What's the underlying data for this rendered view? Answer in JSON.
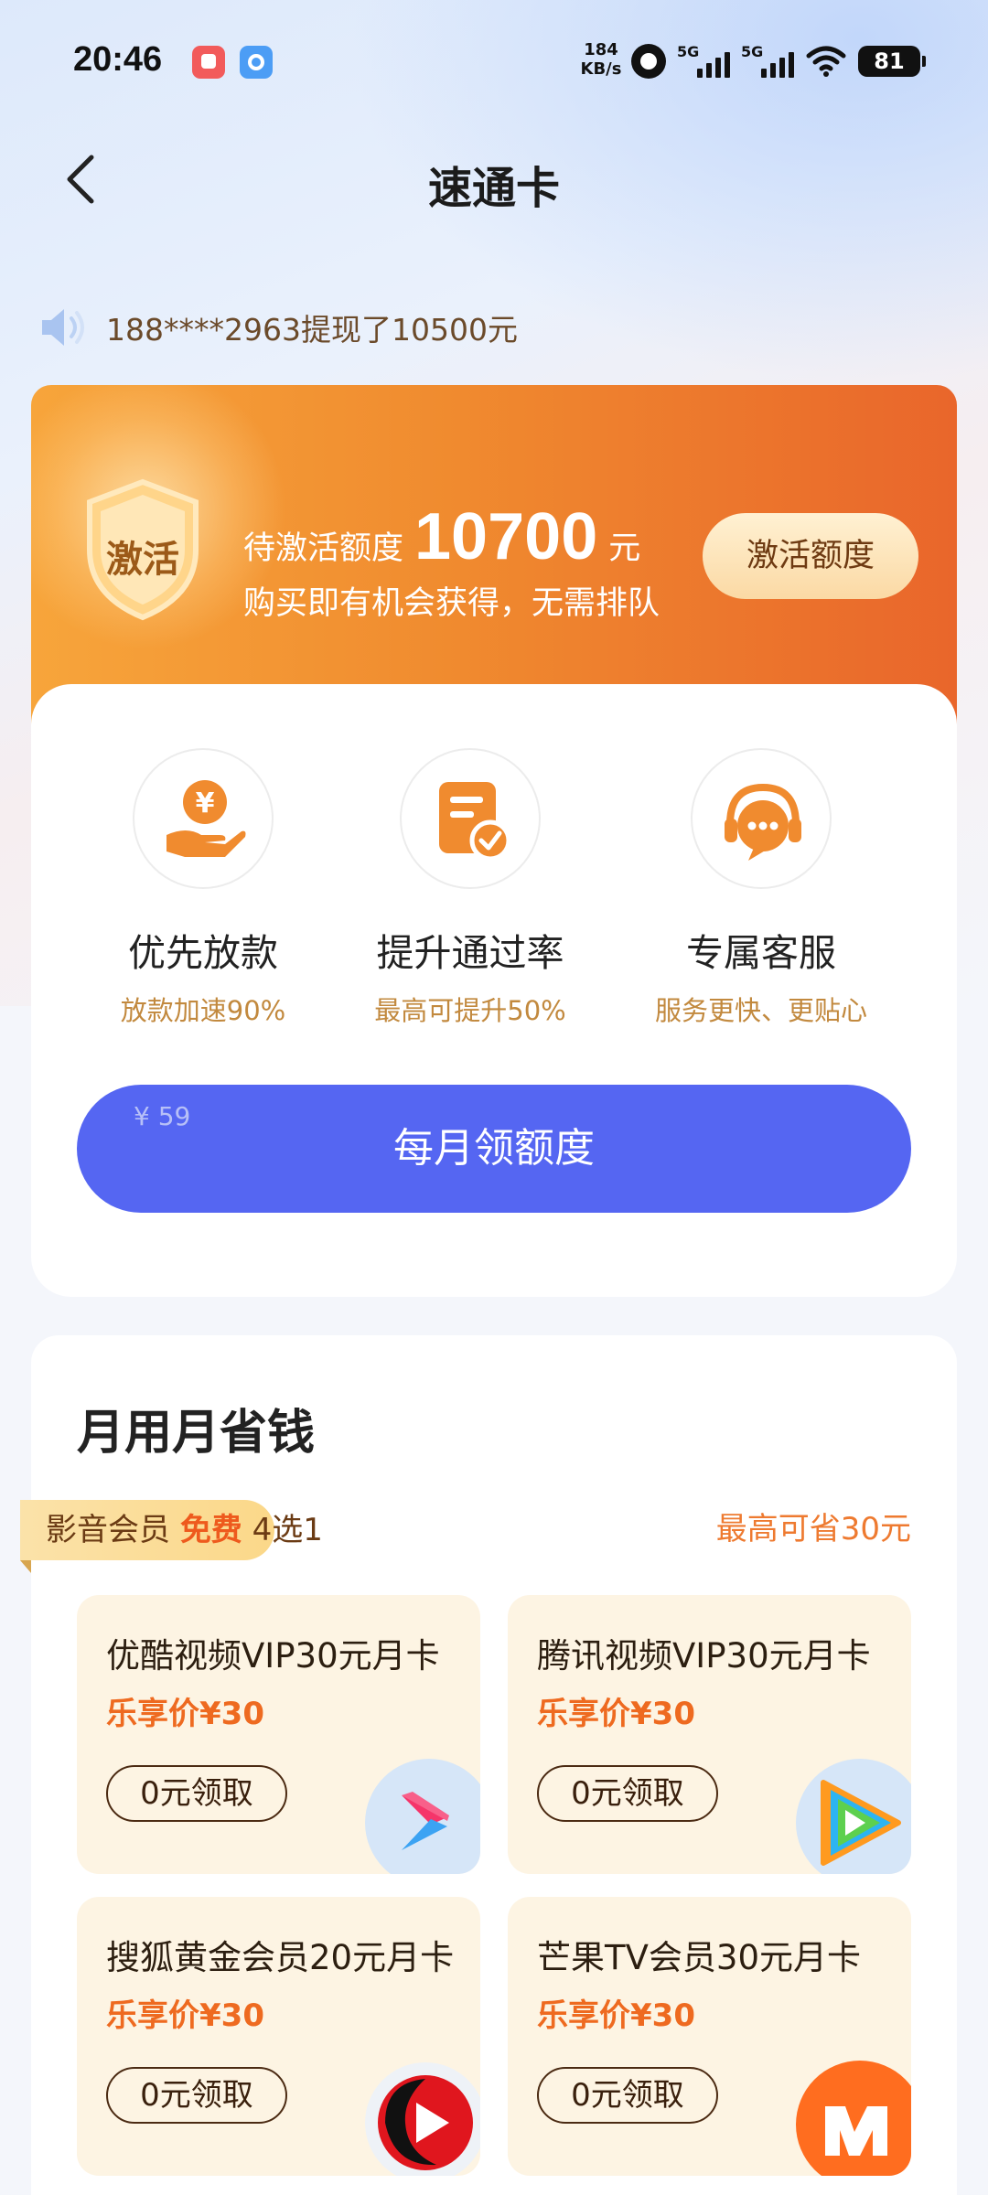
{
  "status_bar": {
    "time": "20:46",
    "net_speed_value": "184",
    "net_speed_unit": "KB/s",
    "signal1_label": "5G",
    "signal2_label": "5G",
    "battery": "81",
    "icons": [
      "app-notification-icon",
      "app-browser-icon",
      "alarm-icon",
      "signal-icon",
      "wifi-icon",
      "battery-icon"
    ]
  },
  "header": {
    "title": "速通卡",
    "back_icon": "chevron-left-icon"
  },
  "ticker": {
    "icon": "speaker-icon",
    "text": "188****2963提现了10500元"
  },
  "activation": {
    "badge_text": "激活",
    "label": "待激活额度",
    "amount": "10700",
    "unit": "元",
    "subtitle": "购买即有机会获得，无需排队",
    "button_label": "激活额度"
  },
  "benefits": {
    "items": [
      {
        "title": "优先放款",
        "subtitle": "放款加速90%",
        "icon": "hand-yen-icon"
      },
      {
        "title": "提升通过率",
        "subtitle": "最高可提升50%",
        "icon": "document-check-icon"
      },
      {
        "title": "专属客服",
        "subtitle": "服务更快、更贴心",
        "icon": "headset-chat-icon"
      }
    ],
    "price_tag": "¥ 59",
    "button_label": "每月领额度"
  },
  "savings": {
    "title": "月用月省钱",
    "tag_prefix": "影音会员",
    "tag_free": "免费",
    "tag_suffix": "4选1",
    "max_save": "最高可省30元",
    "items": [
      {
        "name": "优酷视频VIP30元月卡",
        "price": "乐享价¥30",
        "button": "0元领取",
        "logo": "youku-logo-icon"
      },
      {
        "name": "腾讯视频VIP30元月卡",
        "price": "乐享价¥30",
        "button": "0元领取",
        "logo": "tencent-video-logo-icon"
      },
      {
        "name": "搜狐黄金会员20元月卡",
        "price": "乐享价¥30",
        "button": "0元领取",
        "logo": "sohu-video-logo-icon"
      },
      {
        "name": "芒果TV会员30元月卡",
        "price": "乐享价¥30",
        "button": "0元领取",
        "logo": "mango-tv-logo-icon"
      }
    ]
  },
  "colors": {
    "accent_blue": "#5566f2",
    "orange": "#f08b2f",
    "price_orange": "#ee6a20",
    "gold_text": "#c2893e"
  }
}
